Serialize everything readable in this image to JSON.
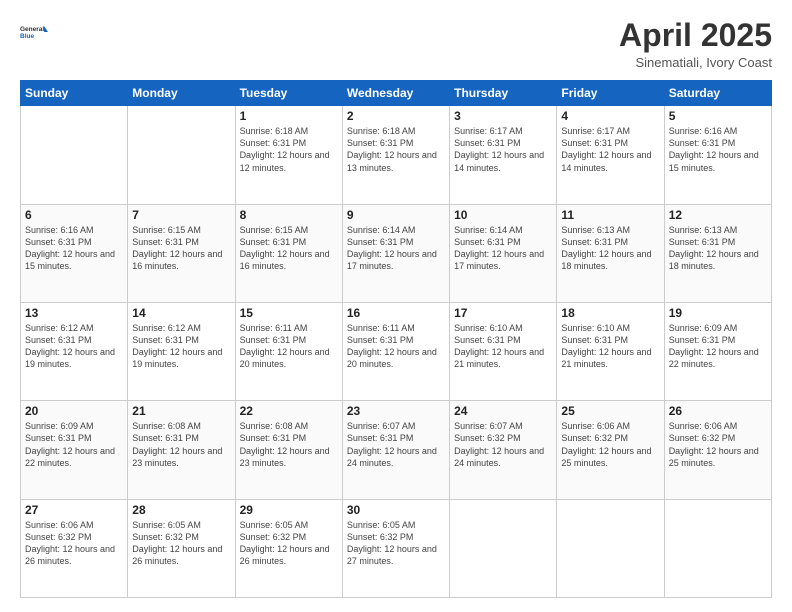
{
  "header": {
    "logo_general": "General",
    "logo_blue": "Blue",
    "month_title": "April 2025",
    "location": "Sinematiali, Ivory Coast"
  },
  "weekdays": [
    "Sunday",
    "Monday",
    "Tuesday",
    "Wednesday",
    "Thursday",
    "Friday",
    "Saturday"
  ],
  "weeks": [
    [
      {
        "day": "",
        "sunrise": "",
        "sunset": "",
        "daylight": ""
      },
      {
        "day": "",
        "sunrise": "",
        "sunset": "",
        "daylight": ""
      },
      {
        "day": "1",
        "sunrise": "Sunrise: 6:18 AM",
        "sunset": "Sunset: 6:31 PM",
        "daylight": "Daylight: 12 hours and 12 minutes."
      },
      {
        "day": "2",
        "sunrise": "Sunrise: 6:18 AM",
        "sunset": "Sunset: 6:31 PM",
        "daylight": "Daylight: 12 hours and 13 minutes."
      },
      {
        "day": "3",
        "sunrise": "Sunrise: 6:17 AM",
        "sunset": "Sunset: 6:31 PM",
        "daylight": "Daylight: 12 hours and 14 minutes."
      },
      {
        "day": "4",
        "sunrise": "Sunrise: 6:17 AM",
        "sunset": "Sunset: 6:31 PM",
        "daylight": "Daylight: 12 hours and 14 minutes."
      },
      {
        "day": "5",
        "sunrise": "Sunrise: 6:16 AM",
        "sunset": "Sunset: 6:31 PM",
        "daylight": "Daylight: 12 hours and 15 minutes."
      }
    ],
    [
      {
        "day": "6",
        "sunrise": "Sunrise: 6:16 AM",
        "sunset": "Sunset: 6:31 PM",
        "daylight": "Daylight: 12 hours and 15 minutes."
      },
      {
        "day": "7",
        "sunrise": "Sunrise: 6:15 AM",
        "sunset": "Sunset: 6:31 PM",
        "daylight": "Daylight: 12 hours and 16 minutes."
      },
      {
        "day": "8",
        "sunrise": "Sunrise: 6:15 AM",
        "sunset": "Sunset: 6:31 PM",
        "daylight": "Daylight: 12 hours and 16 minutes."
      },
      {
        "day": "9",
        "sunrise": "Sunrise: 6:14 AM",
        "sunset": "Sunset: 6:31 PM",
        "daylight": "Daylight: 12 hours and 17 minutes."
      },
      {
        "day": "10",
        "sunrise": "Sunrise: 6:14 AM",
        "sunset": "Sunset: 6:31 PM",
        "daylight": "Daylight: 12 hours and 17 minutes."
      },
      {
        "day": "11",
        "sunrise": "Sunrise: 6:13 AM",
        "sunset": "Sunset: 6:31 PM",
        "daylight": "Daylight: 12 hours and 18 minutes."
      },
      {
        "day": "12",
        "sunrise": "Sunrise: 6:13 AM",
        "sunset": "Sunset: 6:31 PM",
        "daylight": "Daylight: 12 hours and 18 minutes."
      }
    ],
    [
      {
        "day": "13",
        "sunrise": "Sunrise: 6:12 AM",
        "sunset": "Sunset: 6:31 PM",
        "daylight": "Daylight: 12 hours and 19 minutes."
      },
      {
        "day": "14",
        "sunrise": "Sunrise: 6:12 AM",
        "sunset": "Sunset: 6:31 PM",
        "daylight": "Daylight: 12 hours and 19 minutes."
      },
      {
        "day": "15",
        "sunrise": "Sunrise: 6:11 AM",
        "sunset": "Sunset: 6:31 PM",
        "daylight": "Daylight: 12 hours and 20 minutes."
      },
      {
        "day": "16",
        "sunrise": "Sunrise: 6:11 AM",
        "sunset": "Sunset: 6:31 PM",
        "daylight": "Daylight: 12 hours and 20 minutes."
      },
      {
        "day": "17",
        "sunrise": "Sunrise: 6:10 AM",
        "sunset": "Sunset: 6:31 PM",
        "daylight": "Daylight: 12 hours and 21 minutes."
      },
      {
        "day": "18",
        "sunrise": "Sunrise: 6:10 AM",
        "sunset": "Sunset: 6:31 PM",
        "daylight": "Daylight: 12 hours and 21 minutes."
      },
      {
        "day": "19",
        "sunrise": "Sunrise: 6:09 AM",
        "sunset": "Sunset: 6:31 PM",
        "daylight": "Daylight: 12 hours and 22 minutes."
      }
    ],
    [
      {
        "day": "20",
        "sunrise": "Sunrise: 6:09 AM",
        "sunset": "Sunset: 6:31 PM",
        "daylight": "Daylight: 12 hours and 22 minutes."
      },
      {
        "day": "21",
        "sunrise": "Sunrise: 6:08 AM",
        "sunset": "Sunset: 6:31 PM",
        "daylight": "Daylight: 12 hours and 23 minutes."
      },
      {
        "day": "22",
        "sunrise": "Sunrise: 6:08 AM",
        "sunset": "Sunset: 6:31 PM",
        "daylight": "Daylight: 12 hours and 23 minutes."
      },
      {
        "day": "23",
        "sunrise": "Sunrise: 6:07 AM",
        "sunset": "Sunset: 6:31 PM",
        "daylight": "Daylight: 12 hours and 24 minutes."
      },
      {
        "day": "24",
        "sunrise": "Sunrise: 6:07 AM",
        "sunset": "Sunset: 6:32 PM",
        "daylight": "Daylight: 12 hours and 24 minutes."
      },
      {
        "day": "25",
        "sunrise": "Sunrise: 6:06 AM",
        "sunset": "Sunset: 6:32 PM",
        "daylight": "Daylight: 12 hours and 25 minutes."
      },
      {
        "day": "26",
        "sunrise": "Sunrise: 6:06 AM",
        "sunset": "Sunset: 6:32 PM",
        "daylight": "Daylight: 12 hours and 25 minutes."
      }
    ],
    [
      {
        "day": "27",
        "sunrise": "Sunrise: 6:06 AM",
        "sunset": "Sunset: 6:32 PM",
        "daylight": "Daylight: 12 hours and 26 minutes."
      },
      {
        "day": "28",
        "sunrise": "Sunrise: 6:05 AM",
        "sunset": "Sunset: 6:32 PM",
        "daylight": "Daylight: 12 hours and 26 minutes."
      },
      {
        "day": "29",
        "sunrise": "Sunrise: 6:05 AM",
        "sunset": "Sunset: 6:32 PM",
        "daylight": "Daylight: 12 hours and 26 minutes."
      },
      {
        "day": "30",
        "sunrise": "Sunrise: 6:05 AM",
        "sunset": "Sunset: 6:32 PM",
        "daylight": "Daylight: 12 hours and 27 minutes."
      },
      {
        "day": "",
        "sunrise": "",
        "sunset": "",
        "daylight": ""
      },
      {
        "day": "",
        "sunrise": "",
        "sunset": "",
        "daylight": ""
      },
      {
        "day": "",
        "sunrise": "",
        "sunset": "",
        "daylight": ""
      }
    ]
  ]
}
